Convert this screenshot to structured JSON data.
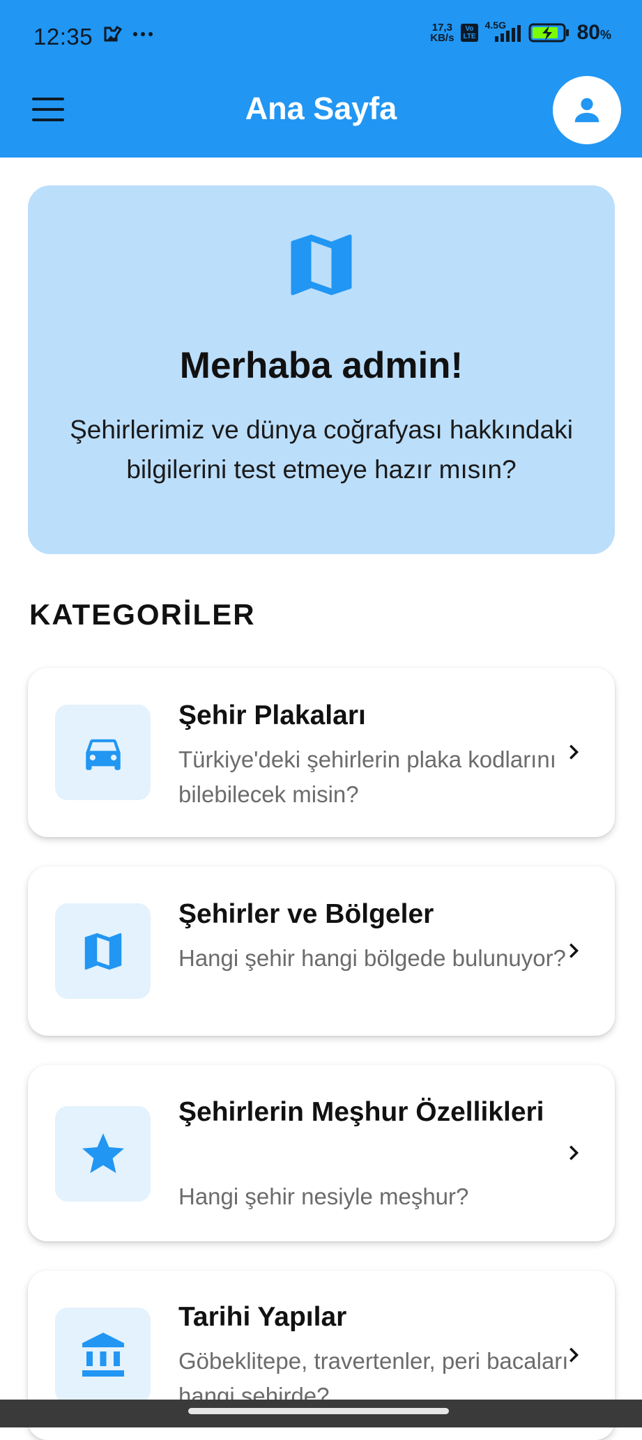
{
  "status_bar": {
    "time": "12:35",
    "net_speed_top": "17,3",
    "net_speed_bottom": "KB/s",
    "volte_top": "Vo",
    "volte_bottom": "LTE",
    "network": "4.5G",
    "battery_percent": "80",
    "battery_unit": "%"
  },
  "app_bar": {
    "title": "Ana Sayfa"
  },
  "hero": {
    "title": "Merhaba admin!",
    "text": "Şehirlerimiz ve dünya coğrafyası hakkındaki bilgilerini test etmeye hazır mısın?"
  },
  "section_title": "KATEGORİLER",
  "categories": [
    {
      "title": "Şehir Plakaları",
      "desc": "Türkiye'deki şehirlerin plaka kodlarını bilebilecek misin?",
      "icon": "car-icon"
    },
    {
      "title": "Şehirler ve Bölgeler",
      "desc": "Hangi şehir hangi bölgede bulunuyor?",
      "icon": "map-icon"
    },
    {
      "title": "Şehirlerin Meşhur Özellikleri",
      "desc": "Hangi şehir nesiyle meşhur?",
      "icon": "star-icon"
    },
    {
      "title": "Tarihi Yapılar",
      "desc": "Göbeklitepe, travertenler, peri bacaları hangi şehirde?",
      "icon": "museum-icon"
    }
  ],
  "colors": {
    "primary": "#2196F3",
    "hero_bg": "#BBDEFB",
    "icon_bg": "#E3F2FD"
  }
}
